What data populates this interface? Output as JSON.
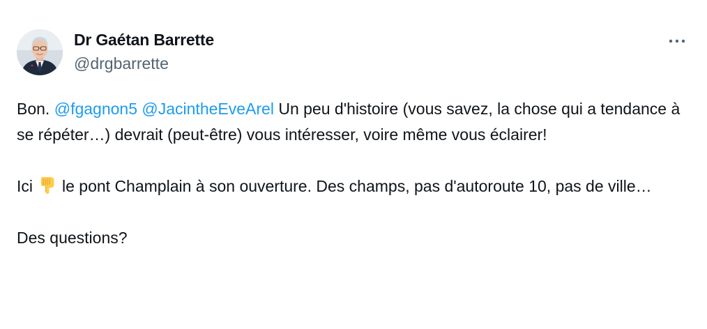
{
  "author": {
    "display_name": "Dr Gaétan Barrette",
    "handle": "@drgbarrette"
  },
  "menu": {
    "icon": "more-horizontal-icon"
  },
  "tweet": {
    "p1_start": "Bon. ",
    "mention1": "@fgagnon5",
    "space": " ",
    "mention2": "@JacintheEveArel",
    "p1_rest": " Un peu d'histoire (vous savez, la chose qui a tendance à se répéter…) devrait (peut-être) vous intéresser, voire même vous éclairer!",
    "p2_start": "Ici",
    "emoji": "backhand-index-pointing-down-emoji",
    "p2_rest": "le pont Champlain à son ouverture.  Des champs, pas d'autoroute 10, pas de ville…",
    "p3": "Des questions?"
  },
  "colors": {
    "text": "#0f1419",
    "secondary": "#536471",
    "link": "#1d9bf0"
  }
}
